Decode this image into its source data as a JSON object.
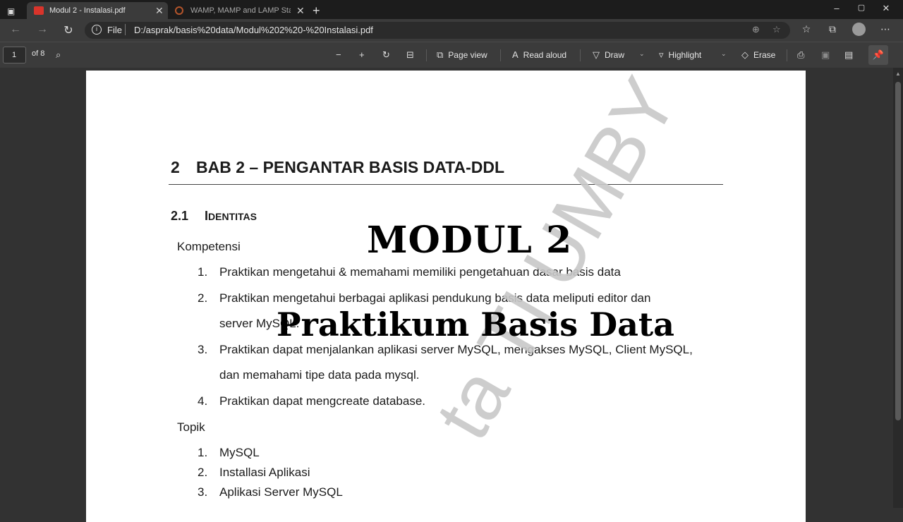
{
  "tabs": [
    {
      "title": "Modul 2 - Instalasi.pdf",
      "active": true
    },
    {
      "title": "WAMP, MAMP and LAMP Stack",
      "active": false
    }
  ],
  "address": {
    "scheme": "File",
    "path": "D:/asprak/basis%20data/Modul%202%20-%20Instalasi.pdf"
  },
  "pdf_toolbar": {
    "page_number": "1",
    "page_total": "of 8",
    "page_view": "Page view",
    "read_aloud": "Read aloud",
    "draw": "Draw",
    "highlight": "Highlight",
    "erase": "Erase"
  },
  "document": {
    "chapter_number": "2",
    "chapter_title": "BAB 2 – PENGANTAR BASIS DATA-DDL",
    "section_number": "2.1",
    "section_title_cap": "I",
    "section_title_rest": "DENTITAS",
    "competency_heading": "Kompetensi",
    "competencies": [
      {
        "n": "1.",
        "text": "Praktikan mengetahui & memahami memiliki pengetahuan dasar basis data"
      },
      {
        "n": "2.",
        "text": "Praktikan mengetahui berbagai aplikasi pendukung basis data meliputi editor dan",
        "cont": "server MySQL."
      },
      {
        "n": "3.",
        "text": "Praktikan dapat menjalankan aplikasi server MySQL, mengakses MySQL, Client MySQL,",
        "cont": "dan memahami tipe data pada mysql."
      },
      {
        "n": "4.",
        "text": "Praktikan dapat mengcreate database."
      }
    ],
    "topic_heading": "Topik",
    "topics": [
      {
        "n": "1.",
        "text": "MySQL"
      },
      {
        "n": "2.",
        "text": "Installasi Aplikasi"
      },
      {
        "n": "3.",
        "text": "Aplikasi Server MySQL"
      }
    ]
  },
  "overlay": {
    "title_line1": "MODUL 2",
    "title_line2": "Praktikum Basis Data",
    "watermark": "ta TI UMBY"
  }
}
